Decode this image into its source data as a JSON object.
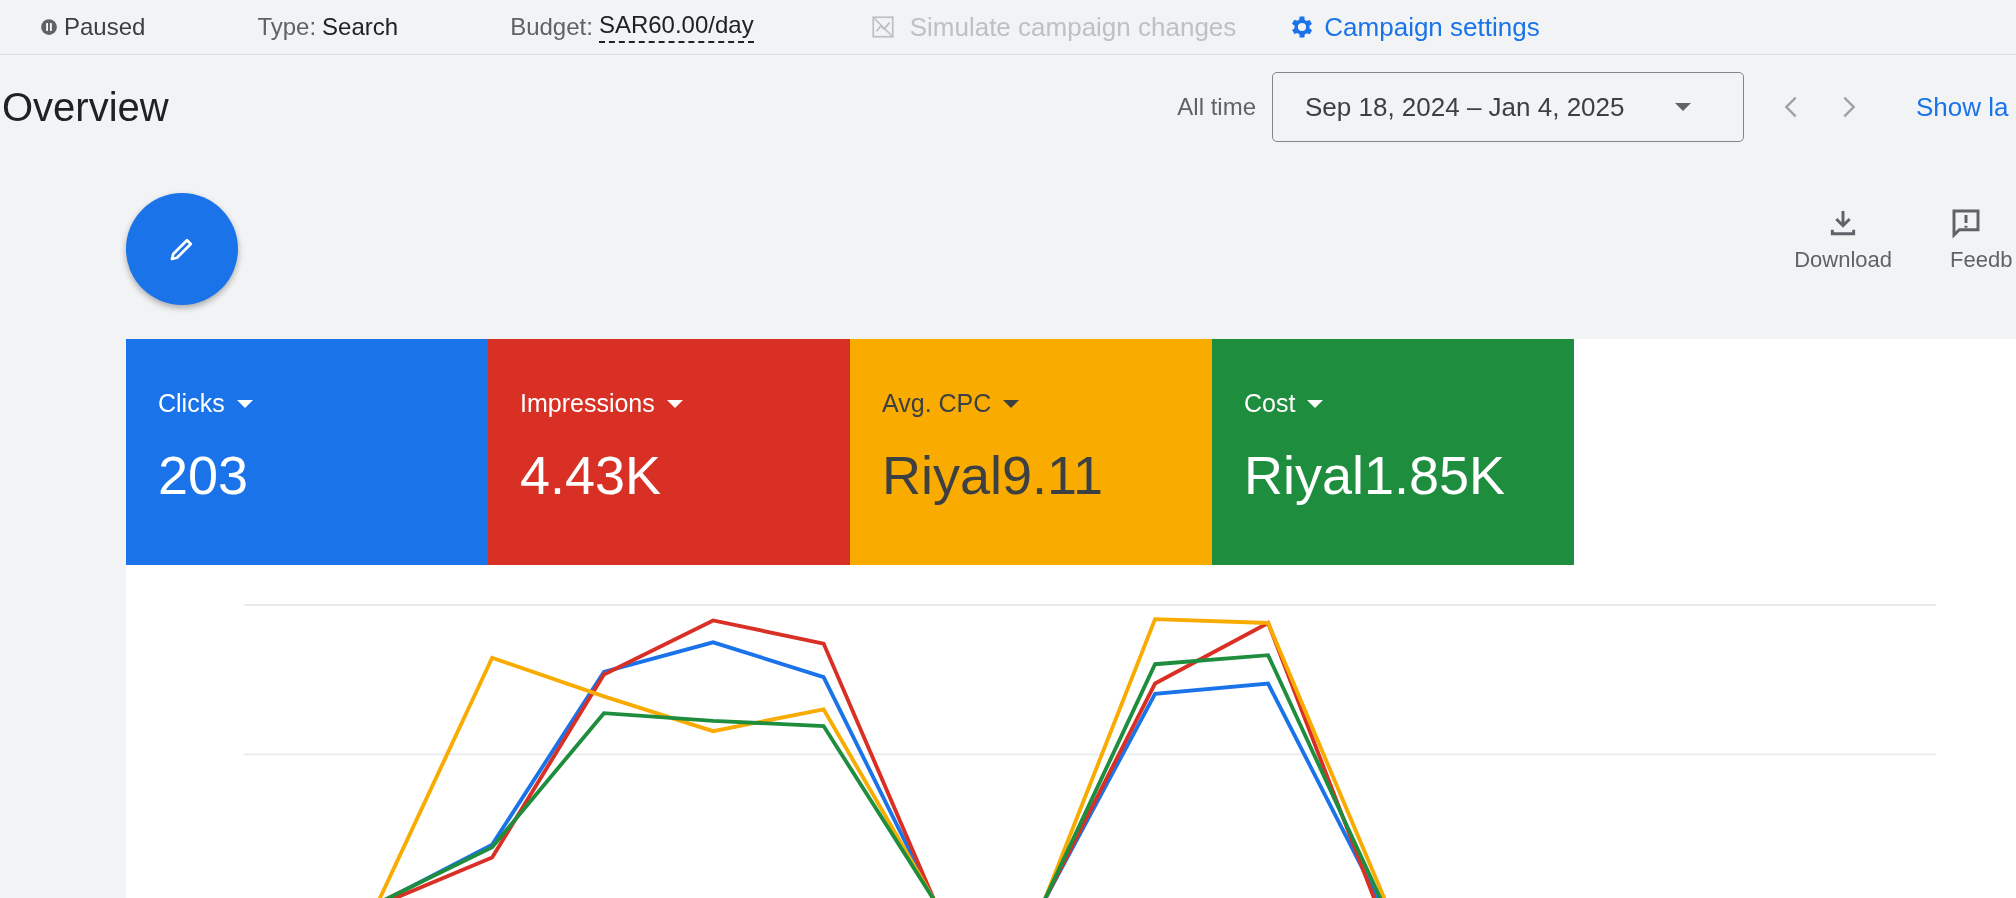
{
  "status_bar": {
    "status": "Paused",
    "type_label": "Type:",
    "type_value": "Search",
    "budget_label": "Budget:",
    "budget_value": "SAR60.00/day",
    "simulate": {
      "label": "Simulate campaign changes",
      "disabled": true
    },
    "settings": "Campaign settings"
  },
  "overview": {
    "title": "Overview",
    "range_label": "All time",
    "date_range": "Sep 18, 2024 – Jan 4, 2025",
    "show_link": "Show la"
  },
  "actions": [
    {
      "label": "Download",
      "kind": "download"
    },
    {
      "label": "Feedb",
      "kind": "feedback"
    }
  ],
  "metrics": [
    {
      "name": "Clicks",
      "value": "203",
      "color": "#1a73e8"
    },
    {
      "name": "Impressions",
      "value": "4.43K",
      "color": "#d93025"
    },
    {
      "name": "Avg. CPC",
      "value": "Riyal9.11",
      "color": "#f9ab00"
    },
    {
      "name": "Cost",
      "value": "Riyal1.85K",
      "color": "#1e8e3e"
    }
  ]
}
